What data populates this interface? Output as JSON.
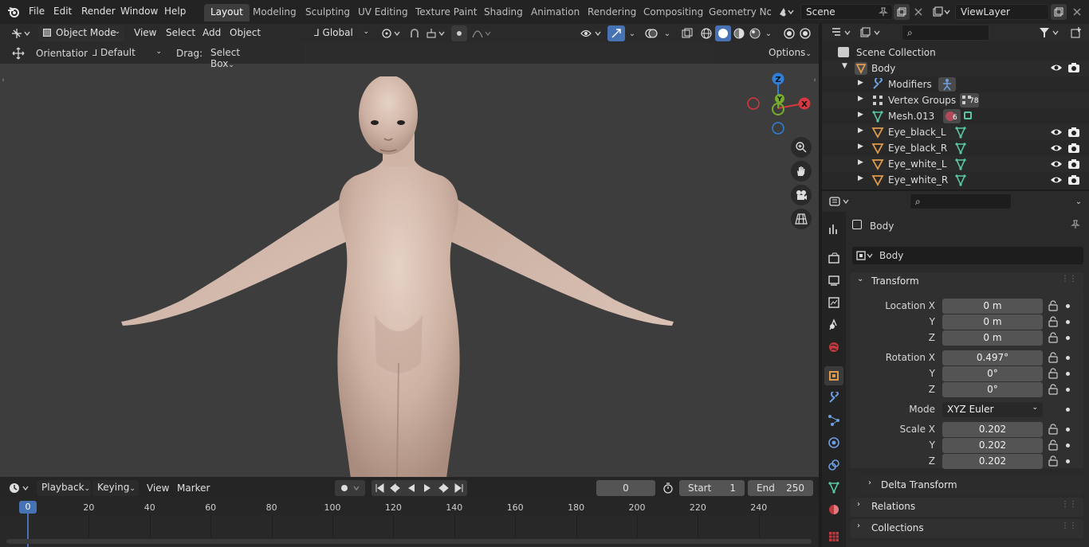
{
  "menu": {
    "file": "File",
    "edit": "Edit",
    "render": "Render",
    "window": "Window",
    "help": "Help"
  },
  "workspaces": [
    "Layout",
    "Modeling",
    "Sculpting",
    "UV Editing",
    "Texture Paint",
    "Shading",
    "Animation",
    "Rendering",
    "Compositing",
    "Geometry Noc"
  ],
  "scene": {
    "name": "Scene",
    "view_layer": "ViewLayer"
  },
  "viewport": {
    "mode": "Object Mode",
    "menus": {
      "view": "View",
      "select": "Select",
      "add": "Add",
      "object": "Object"
    },
    "orientation_global": "Global",
    "orientation_label": "Orientation:",
    "orientation_value": "Default",
    "drag_label": "Drag:",
    "drag_value": "Select Box",
    "options": "Options",
    "gizmo": {
      "z": "Z",
      "y": "Y",
      "x": "X"
    }
  },
  "timeline": {
    "playback": "Playback",
    "keying": "Keying",
    "view": "View",
    "marker": "Marker",
    "current_frame": "0",
    "start_label": "Start",
    "start_value": "1",
    "end_label": "End",
    "end_value": "250",
    "ticks": [
      "0",
      "20",
      "40",
      "60",
      "80",
      "100",
      "120",
      "140",
      "160",
      "180",
      "200",
      "220",
      "240"
    ]
  },
  "outliner": {
    "root": "Scene Collection",
    "body": "Body",
    "children": [
      {
        "label": "Modifiers",
        "badge": ""
      },
      {
        "label": "Vertex Groups",
        "badge": "78"
      },
      {
        "label": "Mesh.013",
        "badge": "6"
      },
      {
        "label": "Eye_black_L",
        "badge": ""
      },
      {
        "label": "Eye_black_R",
        "badge": ""
      },
      {
        "label": "Eye_white_L",
        "badge": ""
      },
      {
        "label": "Eye_white_R",
        "badge": ""
      }
    ]
  },
  "properties": {
    "object_name": "Body",
    "data_name": "Body",
    "transform_title": "Transform",
    "location": {
      "label_x": "Location X",
      "label_y": "Y",
      "label_z": "Z",
      "x": "0 m",
      "y": "0 m",
      "z": "0 m"
    },
    "rotation": {
      "label_x": "Rotation X",
      "label_y": "Y",
      "label_z": "Z",
      "x": "0.497°",
      "y": "0°",
      "z": "0°"
    },
    "mode": {
      "label": "Mode",
      "value": "XYZ Euler"
    },
    "scale": {
      "label_x": "Scale X",
      "label_y": "Y",
      "label_z": "Z",
      "x": "0.202",
      "y": "0.202",
      "z": "0.202"
    },
    "delta_transform": "Delta Transform",
    "relations": "Relations",
    "collections": "Collections"
  },
  "colors": {
    "accent": "#4772b3",
    "object_orange": "#e09a4c",
    "mesh_green": "#58c7a0",
    "axis_x": "#d5383f",
    "axis_y": "#76ad2a",
    "axis_z": "#2f7fd8"
  }
}
